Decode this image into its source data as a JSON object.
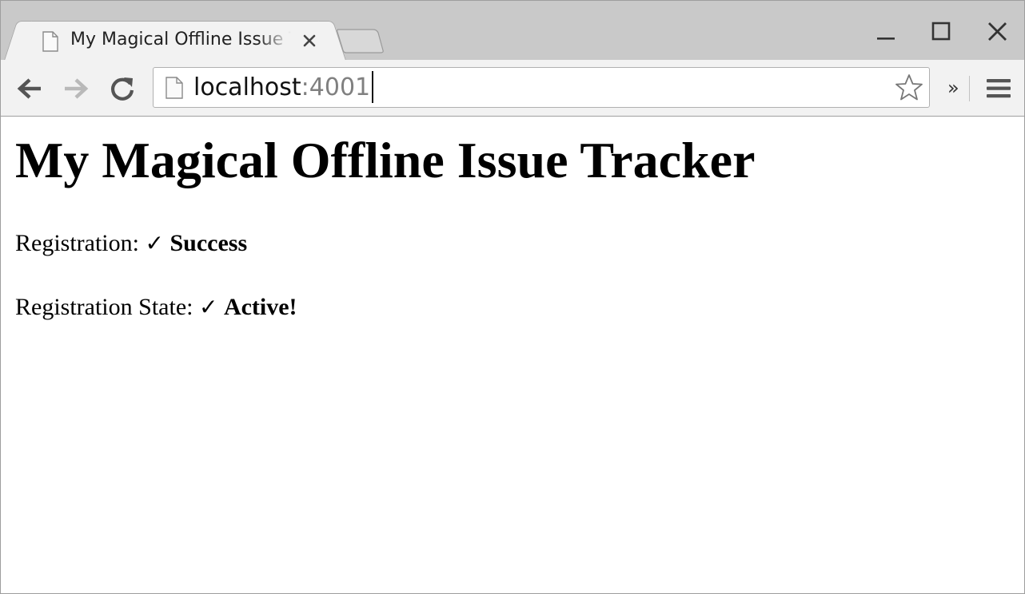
{
  "browser": {
    "tab": {
      "title": "My Magical Offline Issue Tracker",
      "close_glyph": "✕"
    },
    "address_bar": {
      "host": "localhost",
      "port": ":4001"
    },
    "overflow_label": "»",
    "icons": {
      "tab_favicon": "page-icon",
      "tab_close": "close-icon",
      "back": "arrow-left-icon",
      "forward": "arrow-right-icon",
      "reload": "reload-icon",
      "bookmark": "star-icon",
      "menu": "hamburger-menu-icon",
      "minimize": "minimize-icon",
      "maximize": "maximize-icon",
      "close_window": "close-icon"
    },
    "colors": {
      "chrome_bg": "#c9c9c9",
      "toolbar_bg": "#f2f2f2",
      "port_text": "#808080"
    }
  },
  "page": {
    "title": "My Magical Offline Issue Tracker",
    "registration": {
      "label": "Registration:",
      "check": "✓",
      "value": "Success"
    },
    "registration_state": {
      "label": "Registration State:",
      "check": "✓",
      "value": "Active!"
    }
  }
}
